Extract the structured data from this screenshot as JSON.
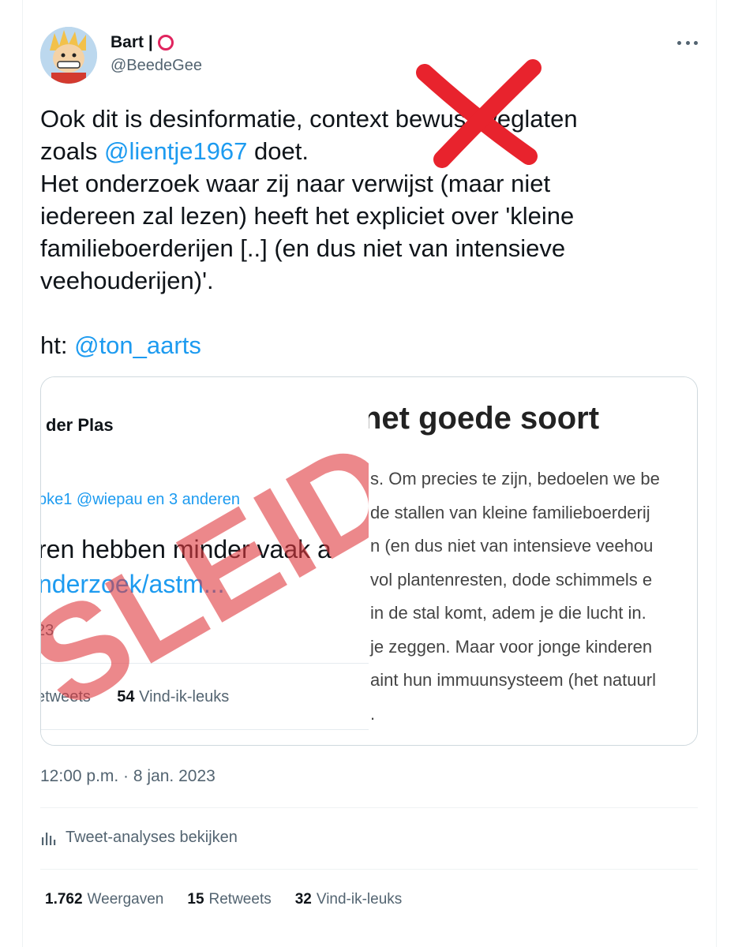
{
  "author": {
    "display_name": "Bart |",
    "handle": "@BeedeGee"
  },
  "tweet": {
    "line1_a": "Ook dit is desinformatie, context bewust weglaten",
    "line2_a": "zoals ",
    "line2_mention": "@lientje1967",
    "line2_b": " doet.",
    "line3": "Het onderzoek waar zij naar verwijst (maar niet",
    "line4": "iedereen zal lezen) heeft het expliciet over 'kleine",
    "line5": "familieboerderijen [..] (en dus niet van intensieve",
    "line6": "veehouderijen)'.",
    "ht_label": "ht: ",
    "ht_mention": "@ton_aarts"
  },
  "media": {
    "left": {
      "name": "der Plas",
      "liked_by": "pke1 @wiepau  en 3 anderen",
      "big_text": "ren hebben minder vaak a",
      "link": "nderzoek/astm...",
      "count": "23",
      "retweets_label": "etweets",
      "likes_count": "54",
      "likes_label": "Vind-ik-leuks",
      "stamp": "SLEID"
    },
    "right": {
      "heading": "net goede soort",
      "lines": [
        "s. Om precies te zijn, bedoelen we be",
        "de stallen van kleine familieboerderij",
        "n (en dus niet van intensieve veehou",
        "vol plantenresten, dode schimmels e",
        "in de stal komt, adem je die lucht in.",
        "je zeggen. Maar voor jonge kinderen",
        "aint hun immuunsysteem (het natuurl",
        "."
      ]
    }
  },
  "timestamp": "12:00 p.m. · 8 jan. 2023",
  "analytics_label": "Tweet-analyses bekijken",
  "stats": {
    "views_count": "1.762",
    "views_label": "Weergaven",
    "retweets_count": "15",
    "retweets_label": "Retweets",
    "likes_count": "32",
    "likes_label": "Vind-ik-leuks"
  },
  "colors": {
    "link": "#1d9bf0",
    "cross": "#e8232d",
    "stamp": "#e0393e"
  }
}
